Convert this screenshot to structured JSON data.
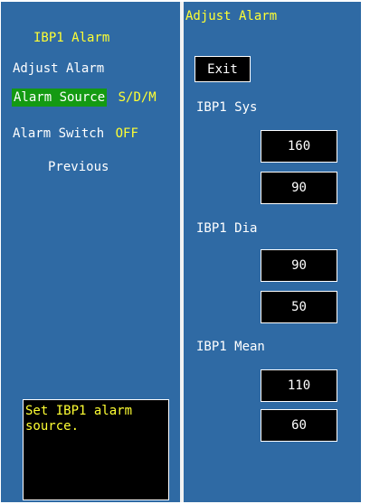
{
  "left_menu": {
    "title": "IBP1 Alarm",
    "adjust_alarm": "Adjust Alarm",
    "alarm_source_label": "Alarm Source",
    "alarm_source_value": "S/D/M",
    "alarm_switch_label": "Alarm Switch",
    "alarm_switch_value": "OFF",
    "previous": "Previous",
    "help_text": "Set IBP1 alarm source."
  },
  "right_panel": {
    "title": "Adjust Alarm",
    "exit_label": "Exit",
    "groups": [
      {
        "label": "IBP1 Sys",
        "high": "160",
        "low": "90"
      },
      {
        "label": "IBP1 Dia",
        "high": "90",
        "low": "50"
      },
      {
        "label": "IBP1 Mean",
        "high": "110",
        "low": "60"
      }
    ]
  },
  "colors": {
    "background": "#2f6aa4",
    "highlight": "#149a12",
    "accent_text": "#ffff33"
  }
}
